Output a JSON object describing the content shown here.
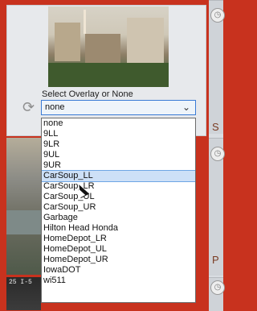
{
  "overlay": {
    "label": "Select Overlay or None",
    "selected_value": "none",
    "options": [
      "none",
      "9LL",
      "9LR",
      "9UL",
      "9UR",
      "CarSoup_LL",
      "CarSoup_LR",
      "CarSoup_UL",
      "CarSoup_UR",
      "Garbage",
      "Hilton Head Honda",
      "HomeDepot_LR",
      "HomeDepot_UL",
      "HomeDepot_UR",
      "IowaDOT",
      "wi511"
    ],
    "highlighted": "CarSoup_LL"
  },
  "side_letters": {
    "s": "S",
    "p": "P"
  },
  "bottom_cam": {
    "label": "25 I-5"
  },
  "colors": {
    "frame": "#c8321e",
    "highlight": "#cde0f7"
  },
  "icons": {
    "refresh": "refresh-icon",
    "dropdown": "chevron-down-icon"
  }
}
